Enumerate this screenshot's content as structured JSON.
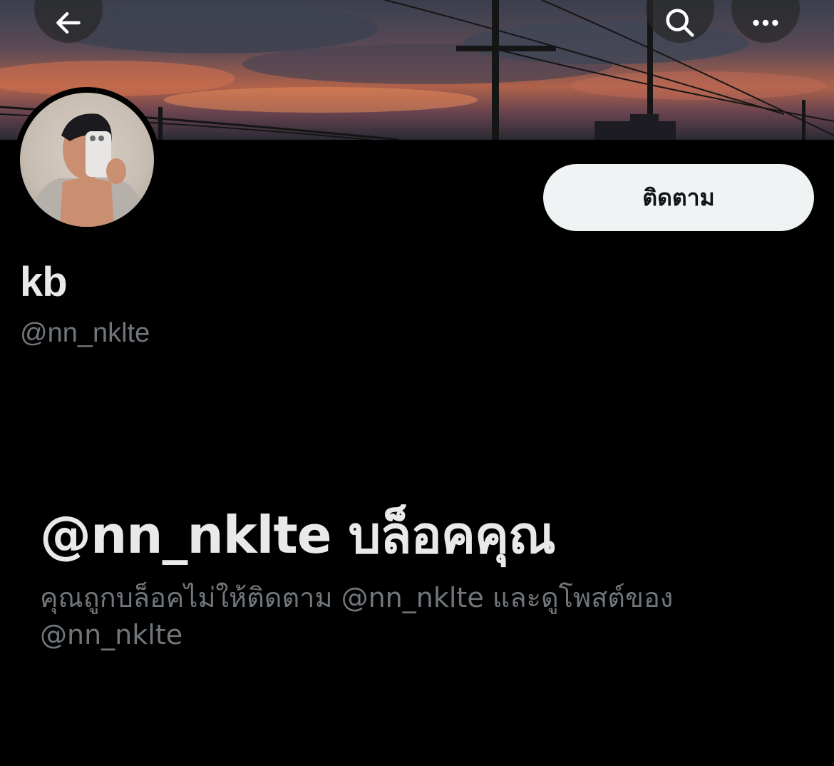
{
  "header": {
    "back_icon": "arrow-left-icon",
    "search_icon": "search-icon",
    "more_icon": "more-horizontal-icon"
  },
  "profile": {
    "display_name": "kb",
    "handle": "@nn_nklte",
    "follow_label": "ติดตาม"
  },
  "blocked": {
    "title": "@nn_nklte บล็อคคุณ",
    "description": "คุณถูกบล็อคไม่ให้ติดตาม @nn_nklte และดูโพสต์ของ @nn_nklte"
  },
  "colors": {
    "background": "#000000",
    "primary_text": "#e7e9ea",
    "secondary_text": "#71767b",
    "button_bg": "#eff3f4",
    "button_text": "#0f1419"
  }
}
